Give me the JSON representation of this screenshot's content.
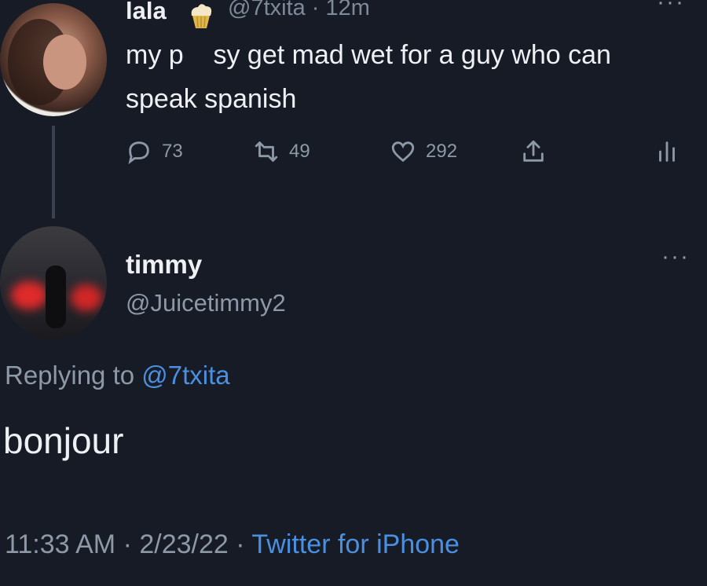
{
  "original_tweet": {
    "display_name": "lala",
    "badge_icon": "cupcake-icon",
    "handle_time": "@7txita · 12m",
    "text": "my p    sy get mad wet for a guy who can speak spanish",
    "actions": {
      "reply_count": "73",
      "retweet_count": "49",
      "like_count": "292"
    }
  },
  "reply_tweet": {
    "display_name": "timmy",
    "handle": "@Juicetimmy2",
    "replying_label": "Replying to ",
    "replying_mention": "@7txita",
    "text": "bonjour",
    "timestamp": "11:33 AM · 2/23/22 · ",
    "source": "Twitter for iPhone"
  },
  "colors": {
    "background": "#161b25",
    "text_primary": "#eef0f3",
    "text_secondary": "#8e99a8",
    "link": "#4a8fe0"
  }
}
